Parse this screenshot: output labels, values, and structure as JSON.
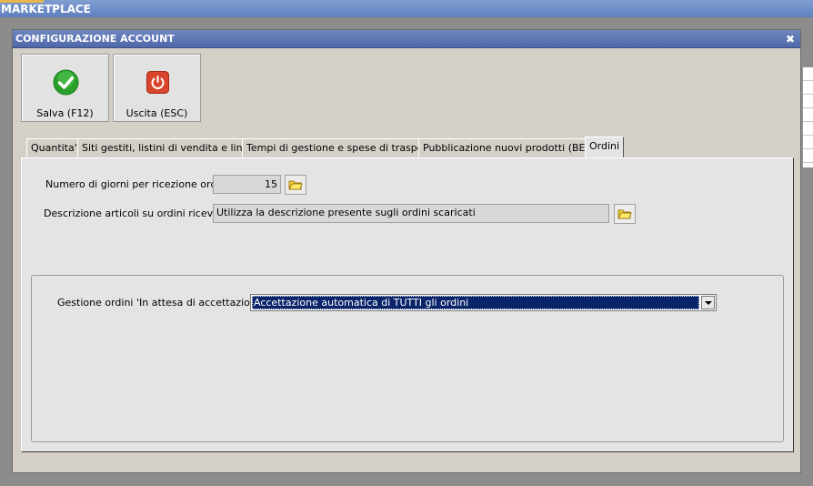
{
  "app": {
    "title": "MARKETPLACE"
  },
  "dialog": {
    "title": "CONFIGURAZIONE ACCOUNT",
    "close_glyph": "✖"
  },
  "toolbar": {
    "save_label": "Salva (F12)",
    "exit_label": "Uscita (ESC)",
    "save_icon": "check-circle-icon",
    "exit_icon": "power-icon"
  },
  "tabs": [
    {
      "label": "Quantita'"
    },
    {
      "label": "Siti gestiti, listini di vendita e lingue"
    },
    {
      "label": "Tempi di gestione e spese di trasporto"
    },
    {
      "label": "Pubblicazione nuovi prodotti (BETA)"
    },
    {
      "label": "Ordini",
      "active": true
    }
  ],
  "ordini": {
    "days_label": "Numero di giorni per ricezione ordini :",
    "days_value": "15",
    "description_label": "Descrizione articoli  su ordini ricevuti :",
    "description_value": "Utilizza la descrizione presente sugli ordini scaricati",
    "pending_label": "Gestione ordini 'In attesa di accettazione' :",
    "pending_value": "Accettazione automatica di TUTTI gli ordini"
  },
  "colors": {
    "title_bar": "#5f7fbf",
    "selection": "#0a246a",
    "save_icon": "#2aa02a",
    "exit_icon": "#d8442c"
  }
}
